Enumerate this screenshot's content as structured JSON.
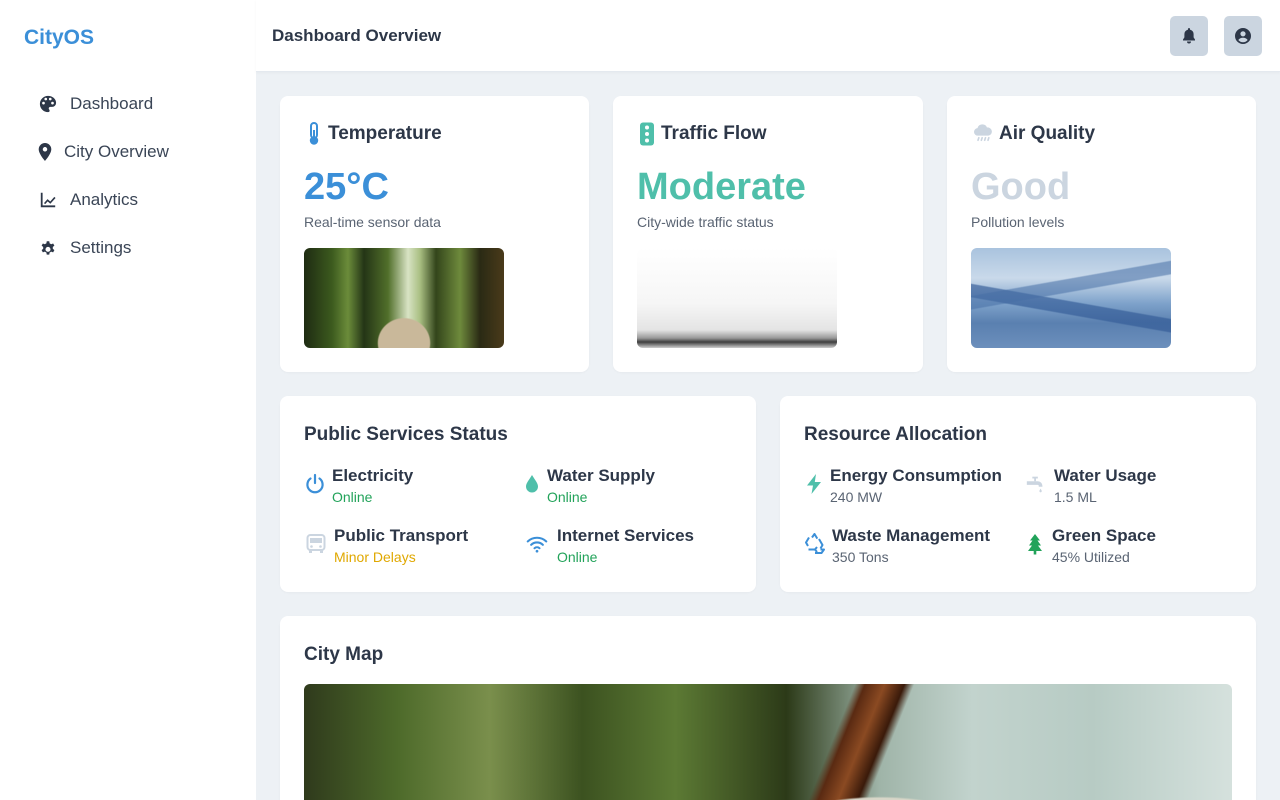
{
  "sidebar": {
    "brand": "CityOS",
    "items": [
      {
        "label": "Dashboard",
        "icon": "palette-icon"
      },
      {
        "label": "City Overview",
        "icon": "map-pin-icon"
      },
      {
        "label": "Analytics",
        "icon": "line-chart-icon"
      },
      {
        "label": "Settings",
        "icon": "gear-icon"
      }
    ]
  },
  "header": {
    "title": "Dashboard Overview",
    "notifications_icon": "bell-icon",
    "profile_icon": "user-circle-icon"
  },
  "metrics": [
    {
      "title": "Temperature",
      "icon": "thermometer-icon",
      "value": "25°C",
      "sub": "Real-time sensor data",
      "color": "#3b8fd8"
    },
    {
      "title": "Traffic Flow",
      "icon": "traffic-light-icon",
      "value": "Moderate",
      "sub": "City-wide traffic status",
      "color": "#4fbfaa"
    },
    {
      "title": "Air Quality",
      "icon": "cloud-rain-icon",
      "value": "Good",
      "sub": "Pollution levels",
      "color": "#cbd5e0"
    }
  ],
  "services": {
    "title": "Public Services Status",
    "items": [
      {
        "name": "Electricity",
        "status": "Online",
        "icon": "power-icon",
        "status_color": "#22a35a"
      },
      {
        "name": "Water Supply",
        "status": "Online",
        "icon": "droplet-icon",
        "status_color": "#22a35a"
      },
      {
        "name": "Public Transport",
        "status": "Minor Delays",
        "icon": "bus-icon",
        "status_color": "#e0a800"
      },
      {
        "name": "Internet Services",
        "status": "Online",
        "icon": "wifi-icon",
        "status_color": "#22a35a"
      }
    ]
  },
  "resources": {
    "title": "Resource Allocation",
    "items": [
      {
        "name": "Energy Consumption",
        "value": "240 MW",
        "icon": "bolt-icon"
      },
      {
        "name": "Water Usage",
        "value": "1.5 ML",
        "icon": "faucet-icon"
      },
      {
        "name": "Waste Management",
        "value": "350 Tons",
        "icon": "recycle-icon"
      },
      {
        "name": "Green Space",
        "value": "45% Utilized",
        "icon": "tree-icon"
      }
    ]
  },
  "map": {
    "title": "City Map"
  },
  "colors": {
    "accent": "#3b8fd8",
    "teal": "#4fbfaa",
    "muted": "#cbd5e0",
    "online": "#22a35a",
    "warning": "#e0a800"
  }
}
